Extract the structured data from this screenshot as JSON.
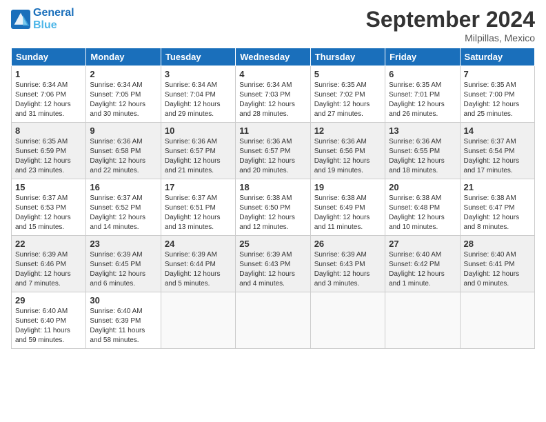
{
  "logo": {
    "line1": "General",
    "line2": "Blue"
  },
  "title": "September 2024",
  "location": "Milpillas, Mexico",
  "weekdays": [
    "Sunday",
    "Monday",
    "Tuesday",
    "Wednesday",
    "Thursday",
    "Friday",
    "Saturday"
  ],
  "weeks": [
    [
      {
        "day": "1",
        "info": "Sunrise: 6:34 AM\nSunset: 7:06 PM\nDaylight: 12 hours\nand 31 minutes."
      },
      {
        "day": "2",
        "info": "Sunrise: 6:34 AM\nSunset: 7:05 PM\nDaylight: 12 hours\nand 30 minutes."
      },
      {
        "day": "3",
        "info": "Sunrise: 6:34 AM\nSunset: 7:04 PM\nDaylight: 12 hours\nand 29 minutes."
      },
      {
        "day": "4",
        "info": "Sunrise: 6:34 AM\nSunset: 7:03 PM\nDaylight: 12 hours\nand 28 minutes."
      },
      {
        "day": "5",
        "info": "Sunrise: 6:35 AM\nSunset: 7:02 PM\nDaylight: 12 hours\nand 27 minutes."
      },
      {
        "day": "6",
        "info": "Sunrise: 6:35 AM\nSunset: 7:01 PM\nDaylight: 12 hours\nand 26 minutes."
      },
      {
        "day": "7",
        "info": "Sunrise: 6:35 AM\nSunset: 7:00 PM\nDaylight: 12 hours\nand 25 minutes."
      }
    ],
    [
      {
        "day": "8",
        "info": "Sunrise: 6:35 AM\nSunset: 6:59 PM\nDaylight: 12 hours\nand 23 minutes."
      },
      {
        "day": "9",
        "info": "Sunrise: 6:36 AM\nSunset: 6:58 PM\nDaylight: 12 hours\nand 22 minutes."
      },
      {
        "day": "10",
        "info": "Sunrise: 6:36 AM\nSunset: 6:57 PM\nDaylight: 12 hours\nand 21 minutes."
      },
      {
        "day": "11",
        "info": "Sunrise: 6:36 AM\nSunset: 6:57 PM\nDaylight: 12 hours\nand 20 minutes."
      },
      {
        "day": "12",
        "info": "Sunrise: 6:36 AM\nSunset: 6:56 PM\nDaylight: 12 hours\nand 19 minutes."
      },
      {
        "day": "13",
        "info": "Sunrise: 6:36 AM\nSunset: 6:55 PM\nDaylight: 12 hours\nand 18 minutes."
      },
      {
        "day": "14",
        "info": "Sunrise: 6:37 AM\nSunset: 6:54 PM\nDaylight: 12 hours\nand 17 minutes."
      }
    ],
    [
      {
        "day": "15",
        "info": "Sunrise: 6:37 AM\nSunset: 6:53 PM\nDaylight: 12 hours\nand 15 minutes."
      },
      {
        "day": "16",
        "info": "Sunrise: 6:37 AM\nSunset: 6:52 PM\nDaylight: 12 hours\nand 14 minutes."
      },
      {
        "day": "17",
        "info": "Sunrise: 6:37 AM\nSunset: 6:51 PM\nDaylight: 12 hours\nand 13 minutes."
      },
      {
        "day": "18",
        "info": "Sunrise: 6:38 AM\nSunset: 6:50 PM\nDaylight: 12 hours\nand 12 minutes."
      },
      {
        "day": "19",
        "info": "Sunrise: 6:38 AM\nSunset: 6:49 PM\nDaylight: 12 hours\nand 11 minutes."
      },
      {
        "day": "20",
        "info": "Sunrise: 6:38 AM\nSunset: 6:48 PM\nDaylight: 12 hours\nand 10 minutes."
      },
      {
        "day": "21",
        "info": "Sunrise: 6:38 AM\nSunset: 6:47 PM\nDaylight: 12 hours\nand 8 minutes."
      }
    ],
    [
      {
        "day": "22",
        "info": "Sunrise: 6:39 AM\nSunset: 6:46 PM\nDaylight: 12 hours\nand 7 minutes."
      },
      {
        "day": "23",
        "info": "Sunrise: 6:39 AM\nSunset: 6:45 PM\nDaylight: 12 hours\nand 6 minutes."
      },
      {
        "day": "24",
        "info": "Sunrise: 6:39 AM\nSunset: 6:44 PM\nDaylight: 12 hours\nand 5 minutes."
      },
      {
        "day": "25",
        "info": "Sunrise: 6:39 AM\nSunset: 6:43 PM\nDaylight: 12 hours\nand 4 minutes."
      },
      {
        "day": "26",
        "info": "Sunrise: 6:39 AM\nSunset: 6:43 PM\nDaylight: 12 hours\nand 3 minutes."
      },
      {
        "day": "27",
        "info": "Sunrise: 6:40 AM\nSunset: 6:42 PM\nDaylight: 12 hours\nand 1 minute."
      },
      {
        "day": "28",
        "info": "Sunrise: 6:40 AM\nSunset: 6:41 PM\nDaylight: 12 hours\nand 0 minutes."
      }
    ],
    [
      {
        "day": "29",
        "info": "Sunrise: 6:40 AM\nSunset: 6:40 PM\nDaylight: 11 hours\nand 59 minutes."
      },
      {
        "day": "30",
        "info": "Sunrise: 6:40 AM\nSunset: 6:39 PM\nDaylight: 11 hours\nand 58 minutes."
      },
      null,
      null,
      null,
      null,
      null
    ]
  ]
}
